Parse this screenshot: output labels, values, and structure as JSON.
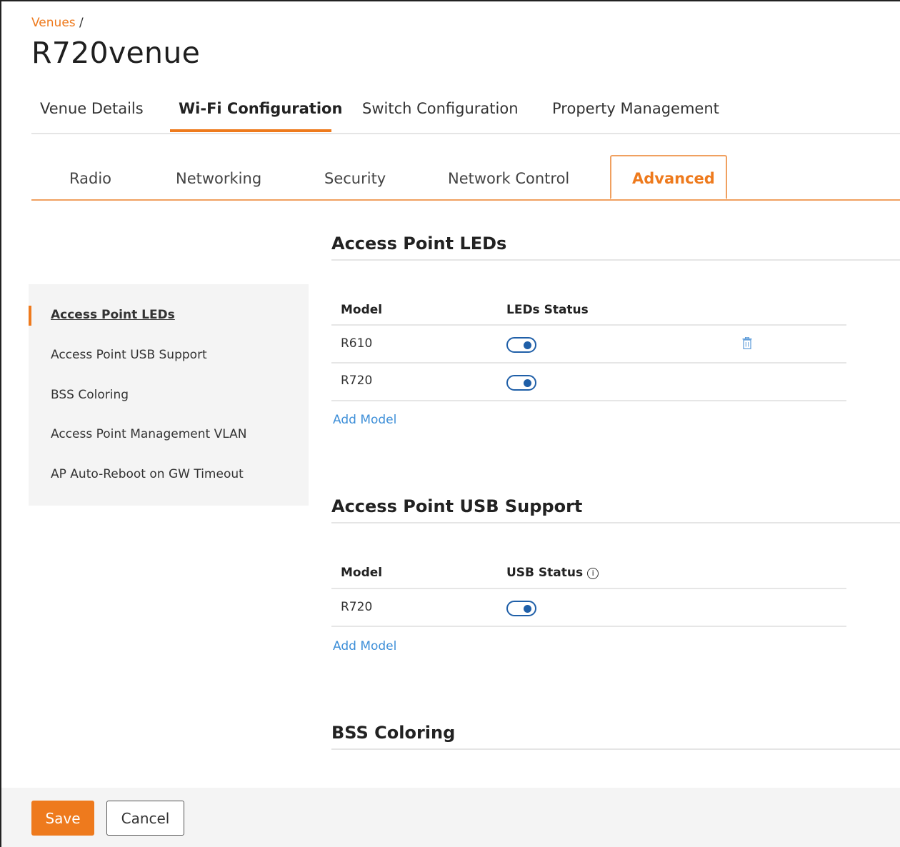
{
  "breadcrumb": {
    "link": "Venues",
    "separator": "/"
  },
  "page_title": "R720venue",
  "main_tabs": [
    {
      "label": "Venue Details"
    },
    {
      "label": "Wi-Fi Configuration",
      "active": true
    },
    {
      "label": "Switch Configuration"
    },
    {
      "label": "Property Management"
    }
  ],
  "sub_tabs": [
    {
      "label": "Radio"
    },
    {
      "label": "Networking"
    },
    {
      "label": "Security"
    },
    {
      "label": "Network Control"
    },
    {
      "label": "Advanced",
      "active": true
    }
  ],
  "side_nav": [
    {
      "label": "Access Point LEDs",
      "active": true
    },
    {
      "label": "Access Point USB Support"
    },
    {
      "label": "BSS Coloring"
    },
    {
      "label": "Access Point Management VLAN"
    },
    {
      "label": "AP Auto-Reboot on GW Timeout"
    }
  ],
  "sections": {
    "leds": {
      "title": "Access Point LEDs",
      "col_model": "Model",
      "col_status": "LEDs Status",
      "rows": [
        {
          "model": "R610",
          "status": "on",
          "delete_icon": "trash-icon"
        },
        {
          "model": "R720",
          "status": "on"
        }
      ],
      "add_label": "Add Model"
    },
    "usb": {
      "title": "Access Point USB Support",
      "col_model": "Model",
      "col_status": "USB Status",
      "status_info_icon": "i",
      "rows": [
        {
          "model": "R720",
          "status": "on"
        }
      ],
      "add_label": "Add Model"
    },
    "bss": {
      "title": "BSS Coloring"
    }
  },
  "footer": {
    "save_label": "Save",
    "cancel_label": "Cancel"
  },
  "colors": {
    "accent": "#ee7a1d",
    "toggle": "#1f5fa8",
    "link": "#3e8fd8"
  }
}
